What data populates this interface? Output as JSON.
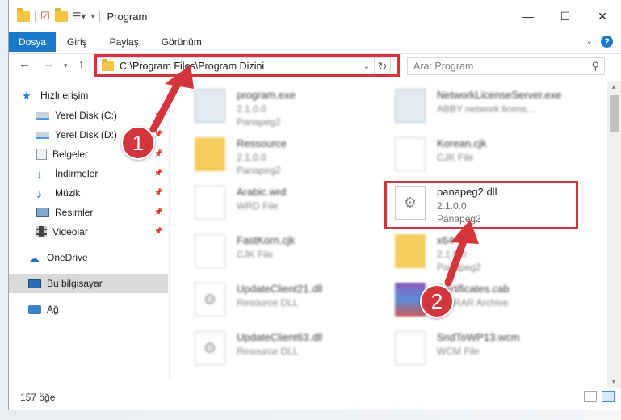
{
  "window": {
    "title": "Program"
  },
  "ribbon": {
    "tabs": [
      "Dosya",
      "Giriş",
      "Paylaş",
      "Görünüm"
    ]
  },
  "nav": {
    "address": "C:\\Program Files\\Program Dizini",
    "search_placeholder": "Ara: Program"
  },
  "sidebar": {
    "items": [
      {
        "label": "Hızlı erişim",
        "icon": "star-icon"
      },
      {
        "label": "Yerel Disk (C:)",
        "icon": "drive-icon",
        "pinned": true
      },
      {
        "label": "Yerel Disk (D:)",
        "icon": "drive-icon",
        "pinned": true
      },
      {
        "label": "Belgeler",
        "icon": "documents-icon",
        "pinned": true
      },
      {
        "label": "İndirmeler",
        "icon": "download-icon",
        "pinned": true
      },
      {
        "label": "Müzik",
        "icon": "music-icon",
        "pinned": true
      },
      {
        "label": "Resimler",
        "icon": "pictures-icon",
        "pinned": true
      },
      {
        "label": "Videolar",
        "icon": "videos-icon",
        "pinned": true
      },
      {
        "label": "OneDrive",
        "icon": "cloud-icon"
      },
      {
        "label": "Bu bilgisayar",
        "icon": "computer-icon",
        "selected": true
      },
      {
        "label": "Ağ",
        "icon": "network-icon"
      }
    ]
  },
  "files": [
    {
      "name": "program.exe",
      "line1": "2.1.0.0",
      "line2": "Panapeg2",
      "icon": "exe-icon"
    },
    {
      "name": "NetworkLicenseServer.exe",
      "line1": "ABBY network licens...",
      "line2": "",
      "icon": "exe-icon"
    },
    {
      "name": "Ressource",
      "line1": "2.1.0.0",
      "line2": "Panapeg2",
      "icon": "folder-icon"
    },
    {
      "name": "Korean.cjk",
      "line1": "CJK File",
      "line2": "",
      "icon": "document-icon"
    },
    {
      "name": "Arabic.wrd",
      "line1": "WRD File",
      "line2": "",
      "icon": "document-icon"
    },
    {
      "name": "panapeg2.dll",
      "line1": "2.1.0.0",
      "line2": "Panapeg2",
      "icon": "dll-icon"
    },
    {
      "name": "FastKorn.cjk",
      "line1": "CJK File",
      "line2": "",
      "icon": "document-icon"
    },
    {
      "name": "x64",
      "line1": "2.1.0.0",
      "line2": "Panapeg2",
      "icon": "folder-icon"
    },
    {
      "name": "UpdateClient21.dll",
      "line1": "Resource DLL",
      "line2": "",
      "icon": "dll-icon"
    },
    {
      "name": "Certificates.cab",
      "line1": "WinRAR Archive",
      "line2": "",
      "icon": "archive-icon"
    },
    {
      "name": "UpdateClient63.dll",
      "line1": "Resource DLL",
      "line2": "",
      "icon": "dll-icon"
    },
    {
      "name": "SndToWP13.wcm",
      "line1": "WCM File",
      "line2": "",
      "icon": "document-icon"
    }
  ],
  "status": {
    "count": "157 öğe"
  },
  "callouts": [
    "1",
    "2"
  ],
  "colors": {
    "accent": "#1979ca",
    "highlight": "#d4343c",
    "folder": "#f4c542"
  }
}
